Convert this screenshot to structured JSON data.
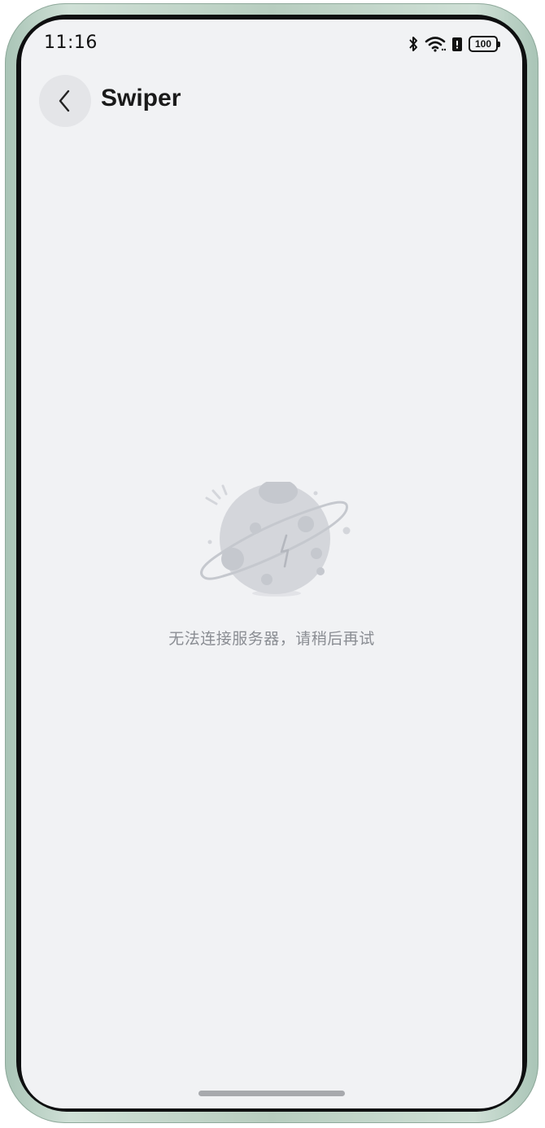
{
  "status_bar": {
    "time": "11:16",
    "battery_level": "100",
    "icons": [
      "bluetooth-icon",
      "wifi-icon",
      "battery-saver-icon",
      "battery-icon"
    ]
  },
  "header": {
    "back_icon": "chevron-left-icon",
    "title": "Swiper"
  },
  "empty_state": {
    "illustration": "planet-disconnected-illustration",
    "message": "无法连接服务器，请稍后再试"
  },
  "colors": {
    "background": "#f1f2f4",
    "illustration": "#d4d6db",
    "message_text": "#8a8d93"
  }
}
